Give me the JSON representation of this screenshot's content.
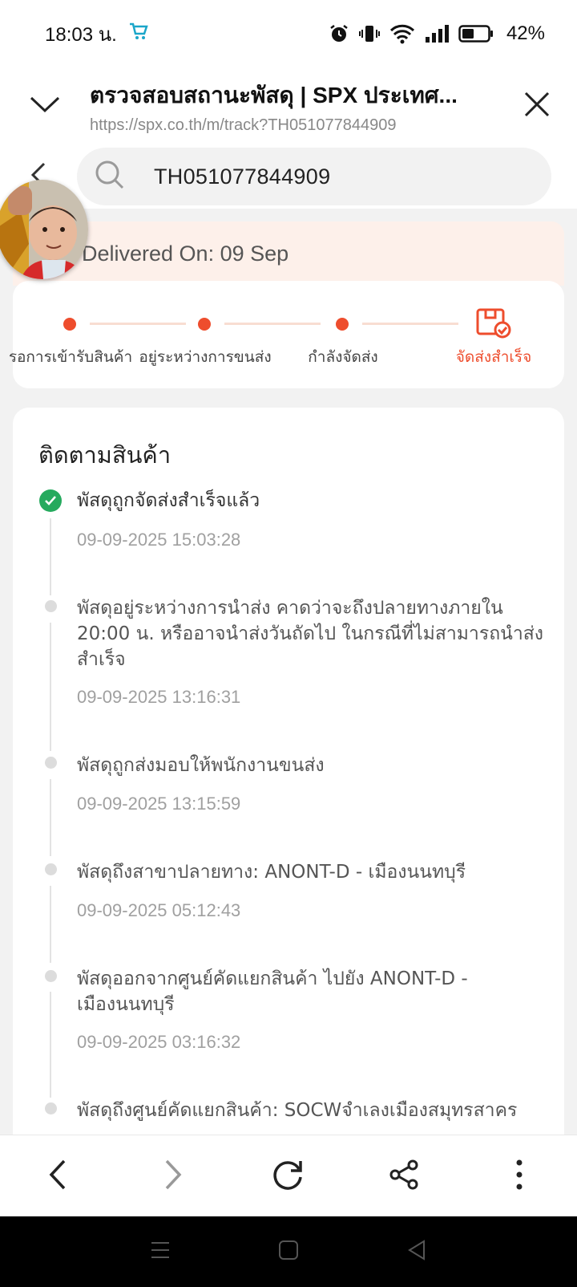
{
  "status_bar": {
    "time": "18:03 น.",
    "battery_percent": "42%",
    "battery_level": 0.42
  },
  "browser": {
    "title": "ตรวจสอบสถานะพัสดุ | SPX ประเทศ...",
    "url": "https://spx.co.th/m/track?TH051077844909"
  },
  "search": {
    "value": "TH051077844909"
  },
  "delivered": {
    "text": "Delivered On: 09 Sep"
  },
  "progress": {
    "steps": [
      {
        "label": "รอการเข้ารับสินค้า"
      },
      {
        "label": "อยู่ระหว่างการขนส่ง"
      },
      {
        "label": "กำลังจัดส่ง"
      },
      {
        "label": "จัดส่งสำเร็จ",
        "active": true
      }
    ],
    "accent_color": "#ee4d2d"
  },
  "tracking": {
    "title": "ติดตามสินค้า",
    "events": [
      {
        "text": "พัสดุถูกจัดส่งสำเร็จแล้ว",
        "time": "09-09-2025 15:03:28"
      },
      {
        "text": "พัสดุอยู่ระหว่างการนำส่ง คาดว่าจะถึงปลายทางภายใน 20:00 น. หรืออาจนำส่งวันถัดไป ในกรณีที่ไม่สามารถนำส่งสำเร็จ",
        "time": "09-09-2025 13:16:31"
      },
      {
        "text": "พัสดุถูกส่งมอบให้พนักงานขนส่ง",
        "time": "09-09-2025 13:15:59"
      },
      {
        "text": "พัสดุถึงสาขาปลายทาง: ANONT-D - เมืองนนทบุรี",
        "time": "09-09-2025 05:12:43"
      },
      {
        "text": "พัสดุออกจากศูนย์คัดแยกสินค้า ไปยัง ANONT-D - เมืองนนทบุรี",
        "time": "09-09-2025 03:16:32"
      },
      {
        "text": "พัสดุถึงศูนย์คัดแยกสินค้า: SOCWจำเลงเมืองสมุทรสาคร",
        "time": ""
      }
    ]
  }
}
